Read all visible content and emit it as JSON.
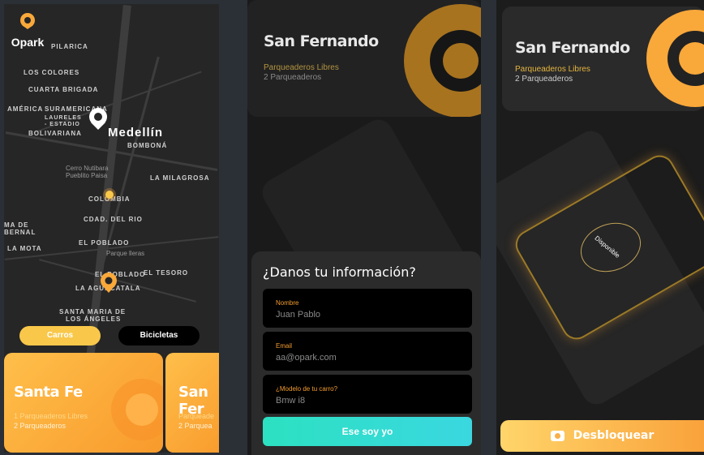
{
  "colors": {
    "accent": "#f9a83a",
    "teal": "#30dcd0",
    "map_bg": "#262626"
  },
  "screen1": {
    "logo": {
      "name": "Opark",
      "icon": "pin-icon"
    },
    "map_labels": {
      "pilarica": "PILARICA",
      "los_colores": "LOS COLORES",
      "cuarta_brigada": "CUARTA BRIGADA",
      "america": "AMÉRICA",
      "suramericana": "SURAMERICANA",
      "laureles": "LAURELES",
      "estadio": "- ESTADIO",
      "bolivariana": "BOLIVARIANA",
      "medellin": "Medellín",
      "bombona": "BOMBONÁ",
      "cerro": "Cerro Nutibara",
      "pueblito": "Pueblito Paisa",
      "milagrosa": "LA MILAGROSA",
      "colombia": "COLOMBIA",
      "cdad_rio": "CDAD. DEL RIO",
      "bernal": "MA DE",
      "bernal2": "BERNAL",
      "mota": "LA MOTA",
      "poblado": "EL POBLADO",
      "parque": "Parque lleras",
      "tesoro": "EL TESORO",
      "poblado2": "EL POBLADO",
      "aguacatala": "LA AGUACATALA",
      "santa_maria": "SANTA MARIA DE",
      "los_angeles": "LOS ÁNGELES"
    },
    "toggle": {
      "cars": "Carros",
      "bikes": "Bicicletas"
    },
    "cards": [
      {
        "title": "Santa Fe",
        "free": "1 Parqueaderos Libres",
        "total": "2 Parqueaderos"
      },
      {
        "title": "San Fer",
        "free": "Parqueade",
        "total": "2 Parquea"
      }
    ]
  },
  "screen2": {
    "header": {
      "title": "San Fernando",
      "free": "Parqueaderos Libres",
      "total": "2 Parqueaderos"
    },
    "form": {
      "title": "¿Danos tu información?",
      "fields": [
        {
          "label": "Nombre",
          "value": "Juan Pablo"
        },
        {
          "label": "Email",
          "value": "aa@opark.com"
        },
        {
          "label": "¿Modelo de tu carro?",
          "value": "Bmw i8"
        }
      ],
      "submit": "Ese soy yo"
    }
  },
  "screen3": {
    "header": {
      "title": "San Fernando",
      "free": "Parqueaderos Libres",
      "total": "2 Parqueaderos"
    },
    "slot_label": "Disponible",
    "unlock": "Desbloquear"
  }
}
